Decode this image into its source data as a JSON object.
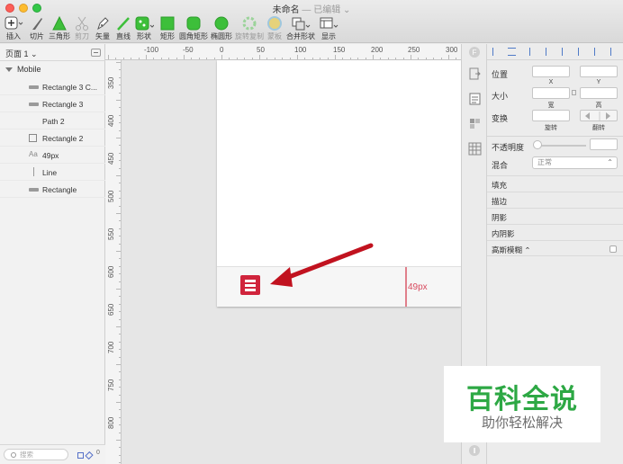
{
  "window": {
    "title": "未命名",
    "subtitle": " — 已编辑 ⌄"
  },
  "toolbar": {
    "insert": "插入",
    "slice": "切片",
    "triangle": "三角形",
    "scissors": "剪刀",
    "vector": "矢量",
    "line": "直线",
    "shape": "形状",
    "rect": "矩形",
    "rounded_rect": "圆角矩形",
    "oval": "椭圆形",
    "rotate_copies": "旋转复制",
    "mask": "蒙板",
    "combine": "合并形状",
    "view": "显示"
  },
  "layers": {
    "page": "页面 1 ⌄",
    "artboard": "Mobile",
    "items": [
      {
        "name": "Rectangle 3 C...",
        "icon": "rectangle-icon"
      },
      {
        "name": "Rectangle 3",
        "icon": "rectangle-icon"
      },
      {
        "name": "Path 2",
        "icon": ""
      },
      {
        "name": "Rectangle 2",
        "icon": "square-outline-icon"
      },
      {
        "name": "49px",
        "icon": "text-icon",
        "icon_text": "Aa"
      },
      {
        "name": "Line",
        "icon": "line-icon"
      },
      {
        "name": "Rectangle",
        "icon": "rectangle-icon"
      }
    ],
    "search_placeholder": "搜索",
    "footer_count": "0"
  },
  "ruler": {
    "top": [
      "-100",
      "-50",
      "0",
      "50",
      "100",
      "150",
      "200",
      "250",
      "300"
    ],
    "left": [
      "350",
      "400",
      "450",
      "500",
      "550",
      "600",
      "650",
      "700",
      "750",
      "800"
    ]
  },
  "canvas": {
    "measure_label": "49px",
    "accent": "#d0243c",
    "arrow_color": "#c1121f"
  },
  "inspector": {
    "position": "位置",
    "x": "X",
    "y": "Y",
    "size": "大小",
    "width": "宽",
    "height": "高",
    "transform": "变换",
    "rotate": "旋转",
    "flip": "翻转",
    "opacity": "不透明度",
    "blend": "混合",
    "blend_value": "正常",
    "fill": "填充",
    "border": "描边",
    "shadow": "阴影",
    "inner_shadow": "内阴影",
    "blur": "高斯模糊 ⌃"
  },
  "watermark": {
    "main": "百科全说",
    "sub": "助你轻松解决"
  }
}
